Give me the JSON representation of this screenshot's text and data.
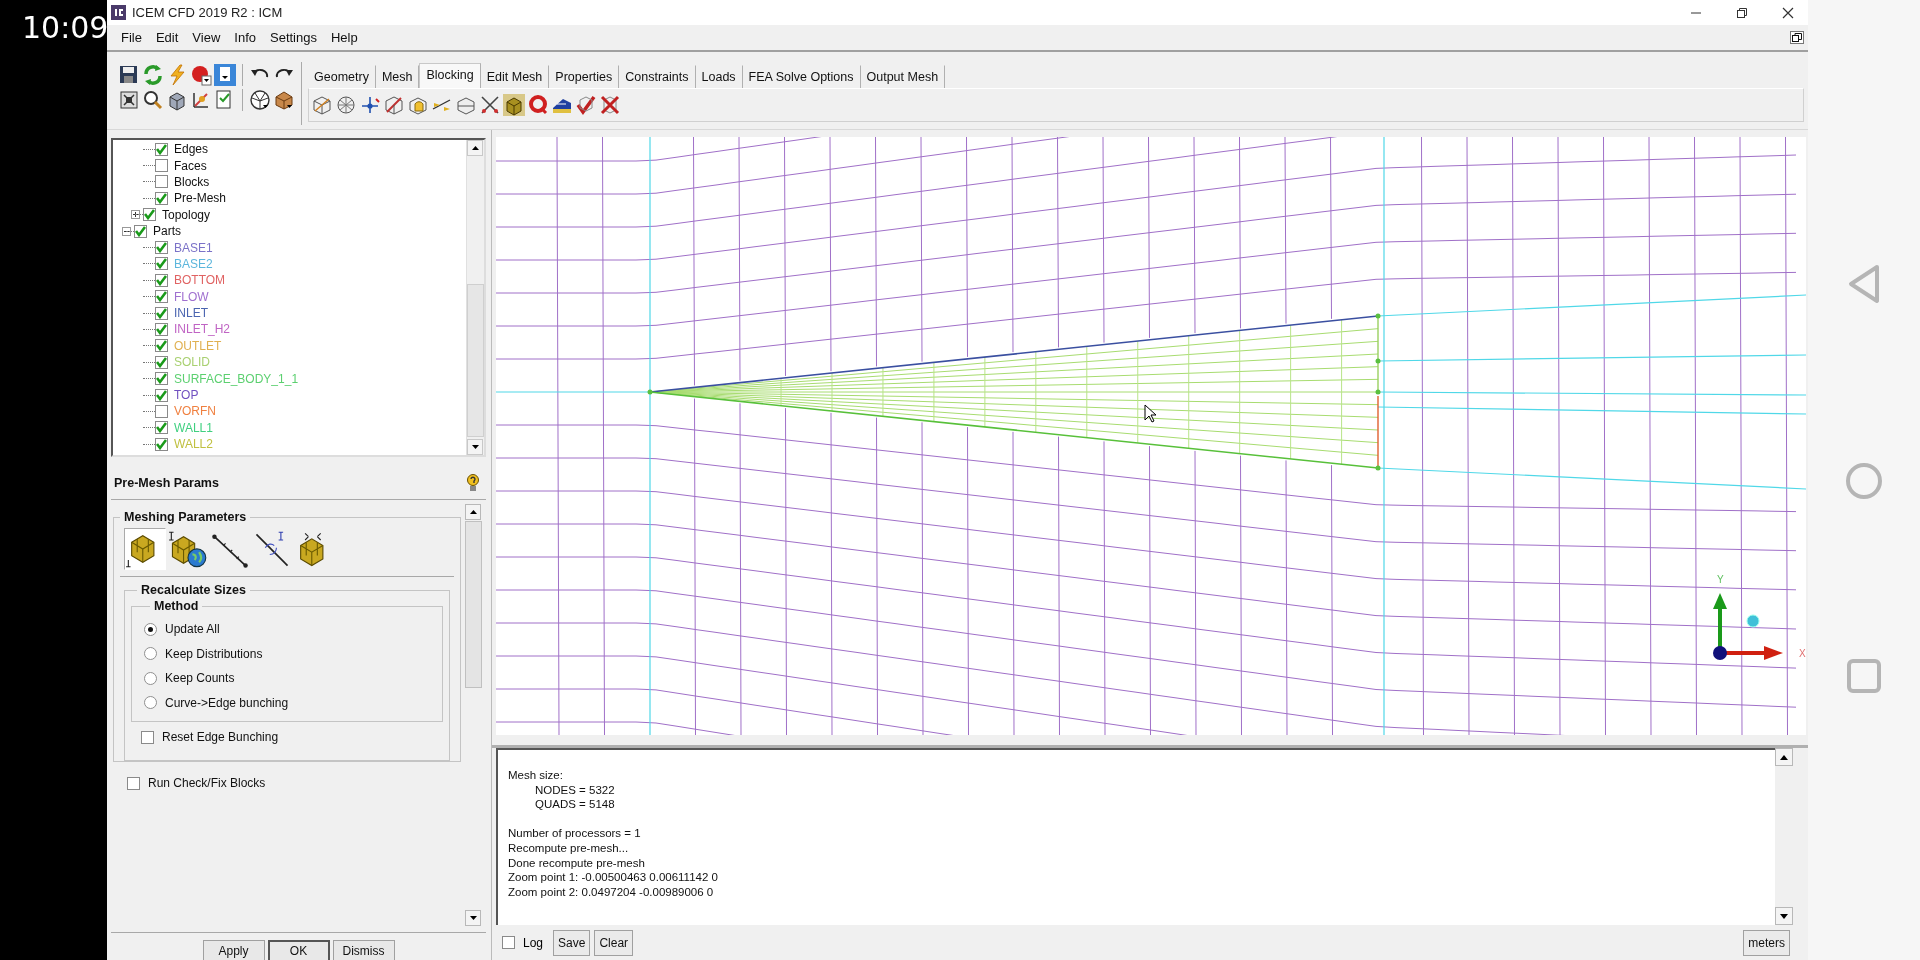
{
  "status_time": "10:09",
  "window": {
    "title": "ICEM CFD 2019 R2 : ICM"
  },
  "menu": [
    "File",
    "Edit",
    "View",
    "Info",
    "Settings",
    "Help"
  ],
  "tabs": [
    {
      "label": "Geometry",
      "selected": false
    },
    {
      "label": "Mesh",
      "selected": false
    },
    {
      "label": "Blocking",
      "selected": true
    },
    {
      "label": "Edit Mesh",
      "selected": false
    },
    {
      "label": "Properties",
      "selected": false
    },
    {
      "label": "Constraints",
      "selected": false
    },
    {
      "label": "Loads",
      "selected": false
    },
    {
      "label": "FEA Solve Options",
      "selected": false
    },
    {
      "label": "Output Mesh",
      "selected": false
    }
  ],
  "tree": {
    "branch_items": [
      {
        "label": "Edges",
        "checked": true
      },
      {
        "label": "Faces",
        "checked": false
      },
      {
        "label": "Blocks",
        "checked": false
      },
      {
        "label": "Pre-Mesh",
        "checked": true
      },
      {
        "label": "Topology",
        "checked": true,
        "expanded": false
      }
    ],
    "items": [
      {
        "label": "Parts",
        "checked": true,
        "expanded": true,
        "children": [
          {
            "label": "BASE1",
            "checked": true,
            "color": "#7b72c8"
          },
          {
            "label": "BASE2",
            "checked": true,
            "color": "#5cb6dc"
          },
          {
            "label": "BOTTOM",
            "checked": true,
            "color": "#e06262"
          },
          {
            "label": "FLOW",
            "checked": true,
            "color": "#a070d0"
          },
          {
            "label": "INLET",
            "checked": true,
            "color": "#4a64b0"
          },
          {
            "label": "INLET_H2",
            "checked": true,
            "color": "#c064c4"
          },
          {
            "label": "OUTLET",
            "checked": true,
            "color": "#e0b050"
          },
          {
            "label": "SOLID",
            "checked": true,
            "color": "#a8d070"
          },
          {
            "label": "SURFACE_BODY_1_1",
            "checked": true,
            "color": "#5cd070"
          },
          {
            "label": "TOP",
            "checked": true,
            "color": "#7050c0"
          },
          {
            "label": "VORFN",
            "checked": false,
            "color": "#f08040"
          },
          {
            "label": "WALL1",
            "checked": true,
            "color": "#40d080"
          },
          {
            "label": "WALL2",
            "checked": true,
            "color": "#c0c040"
          }
        ]
      }
    ]
  },
  "params_panel": {
    "title": "Pre-Mesh Params",
    "section": "Meshing Parameters",
    "group": "Recalculate Sizes",
    "method": {
      "title": "Method",
      "options": [
        {
          "label": "Update All",
          "selected": true
        },
        {
          "label": "Keep Distributions",
          "selected": false
        },
        {
          "label": "Keep Counts",
          "selected": false
        },
        {
          "label": "Curve->Edge bunching",
          "selected": false
        }
      ]
    },
    "group_checkbox": {
      "label": "Reset Edge Bunching",
      "checked": false
    },
    "checkbox": {
      "label": "Run Check/Fix Blocks",
      "checked": false
    },
    "buttons": [
      {
        "label": "Apply",
        "default": false
      },
      {
        "label": "OK",
        "default": true
      },
      {
        "label": "Dismiss",
        "default": false
      }
    ]
  },
  "viewport": {
    "axis_labels": {
      "x": "X",
      "y": "Y"
    }
  },
  "console": {
    "groups": [
      {
        "lines": [
          {
            "text": "Mesh size:",
            "children": [
              {
                "text": "NODES = 5322"
              },
              {
                "text": "QUADS = 5148"
              }
            ]
          }
        ]
      },
      {
        "lines": [
          {
            "text": "Number of processors = 1"
          },
          {
            "text": "Recompute pre-mesh..."
          },
          {
            "text": "Done recompute pre-mesh"
          },
          {
            "text": "Zoom point 1: -0.00500463 0.00611142 0"
          },
          {
            "text": "Zoom point 2: 0.0497204 -0.00989006 0"
          }
        ]
      }
    ],
    "log": {
      "label": "Log",
      "checked": false
    },
    "buttons": [
      "Save",
      "Clear"
    ],
    "units": "meters"
  }
}
